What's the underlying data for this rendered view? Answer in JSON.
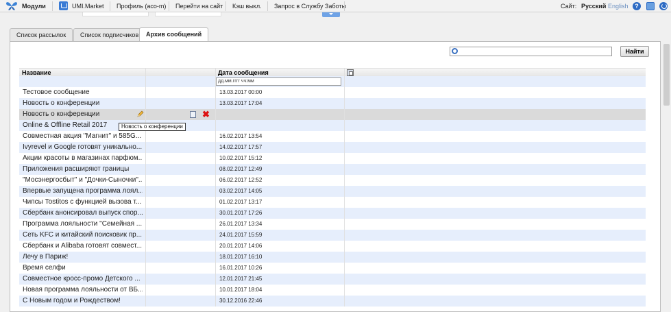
{
  "topbar": {
    "modules": "Модули",
    "umi_market": "UMI.Market",
    "profile": "Профиль (aco-m)",
    "goto_site": "Перейти на сайт",
    "cache": "Кэш выкл.",
    "support": "Запрос в Службу Заботы",
    "site_label": "Сайт:",
    "lang_current": "Русский",
    "lang_other": "English",
    "help": "?"
  },
  "tabs": [
    {
      "label": "Список рассылок"
    },
    {
      "label": "Список подписчиков"
    },
    {
      "label": "Архив сообщений"
    }
  ],
  "search": {
    "button": "Найти",
    "value": ""
  },
  "grid": {
    "col_name": "Название",
    "col_date": "Дата сообщения",
    "date_filter_placeholder": "дд.мм.гггг чч:мм",
    "tooltip": "Новость о конференции",
    "rows": [
      {
        "name": "Тестовое сообщение",
        "date": "13.03.2017 00:00"
      },
      {
        "name": "Новость о конференции",
        "date": "13.03.2017 17:04"
      },
      {
        "name": "Новость о конференции",
        "date": ""
      },
      {
        "name": "Online & Offline Retail 2017",
        "date": ""
      },
      {
        "name": "Совместная акция \"Магнит\" и 585G...",
        "date": "16.02.2017 13:54"
      },
      {
        "name": "Ivyrevel и Google готовят уникально...",
        "date": "14.02.2017 17:57"
      },
      {
        "name": "Акции красоты в магазинах парфюм...",
        "date": "10.02.2017 15:12"
      },
      {
        "name": "Приложения расширяют границы",
        "date": "08.02.2017 12:49"
      },
      {
        "name": "\"Мосэнергосбыт\" и \"Дочки-Сыночки\"...",
        "date": "06.02.2017 12:52"
      },
      {
        "name": "Впервые запущена программа лоял...",
        "date": "03.02.2017 14:05"
      },
      {
        "name": "Чипсы Tostitos с функцией вызова т...",
        "date": "01.02.2017 13:17"
      },
      {
        "name": "Сбербанк анонсировал выпуск спор...",
        "date": "30.01.2017 17:26"
      },
      {
        "name": "Программа лояльности \"Семейная ...",
        "date": "26.01.2017 13:34"
      },
      {
        "name": "Сеть KFC и китайский поисковик пр...",
        "date": "24.01.2017 15:59"
      },
      {
        "name": "Сбербанк и Alibaba готовят совмест...",
        "date": "20.01.2017 14:06"
      },
      {
        "name": "Лечу в Париж!",
        "date": "18.01.2017 16:10"
      },
      {
        "name": "Время селфи",
        "date": "16.01.2017 10:26"
      },
      {
        "name": "Совместное кросс-промо Детского ...",
        "date": "12.01.2017 21:45"
      },
      {
        "name": "Новая программа лояльности от ВБ...",
        "date": "10.01.2017 18:04"
      },
      {
        "name": "С Новым годом и Рождеством!",
        "date": "30.12.2016 22:46"
      }
    ]
  }
}
